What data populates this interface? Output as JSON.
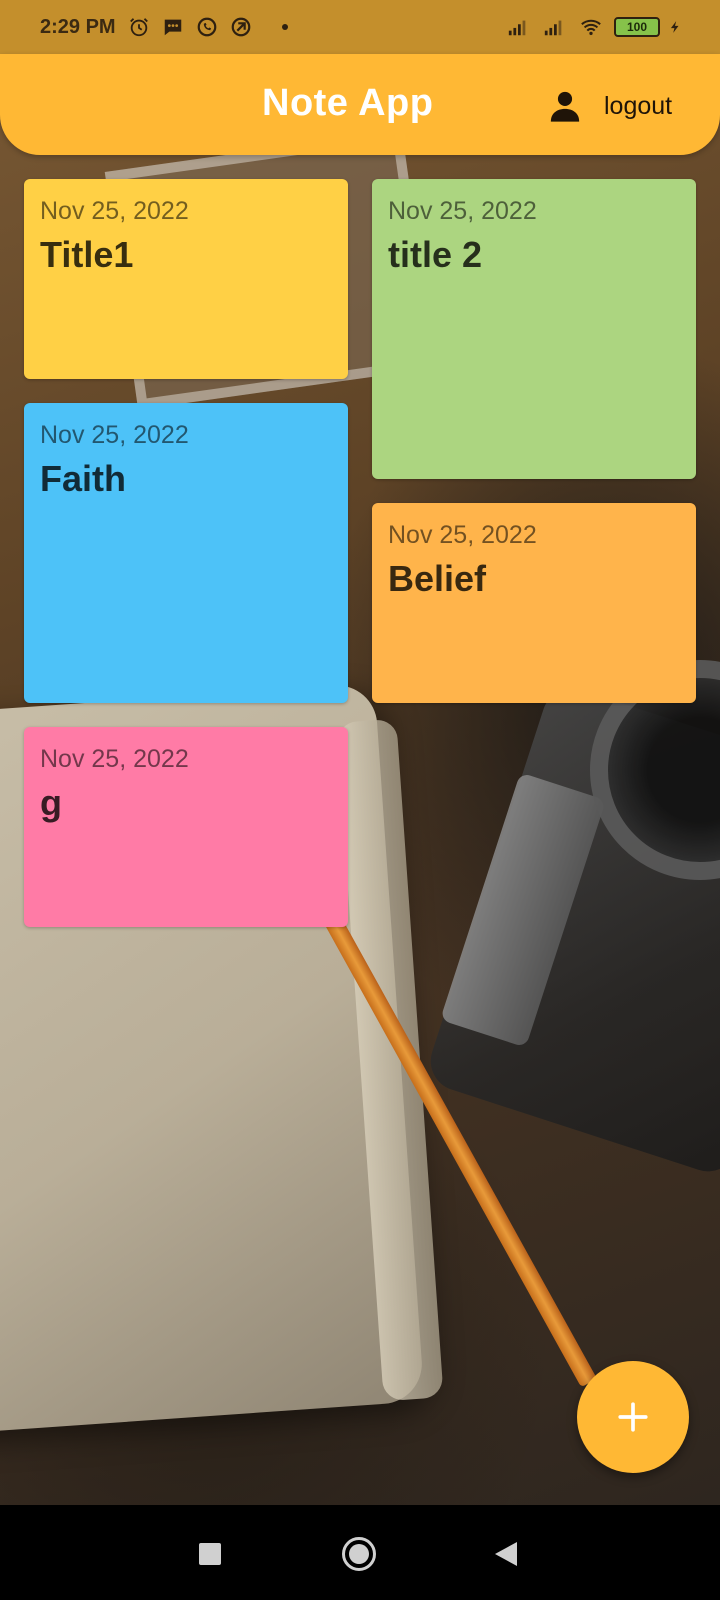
{
  "status_bar": {
    "time": "2:29 PM",
    "battery": "100"
  },
  "app_bar": {
    "title": "Note App",
    "logout_label": "logout"
  },
  "notes": [
    {
      "date": "Nov 25, 2022",
      "title": "Title1",
      "color": "#ffd045"
    },
    {
      "date": "Nov 25, 2022",
      "title": "title 2",
      "color": "#acd580"
    },
    {
      "date": "Nov 25, 2022",
      "title": "Faith",
      "color": "#4dc2f8"
    },
    {
      "date": "Nov 25, 2022",
      "title": "Belief",
      "color": "#ffb44b"
    },
    {
      "date": "Nov 25, 2022",
      "title": "g",
      "color": "#ff7ba6"
    }
  ],
  "colors": {
    "accent": "#ffb834",
    "status_bar_bg": "#c48f2c"
  }
}
